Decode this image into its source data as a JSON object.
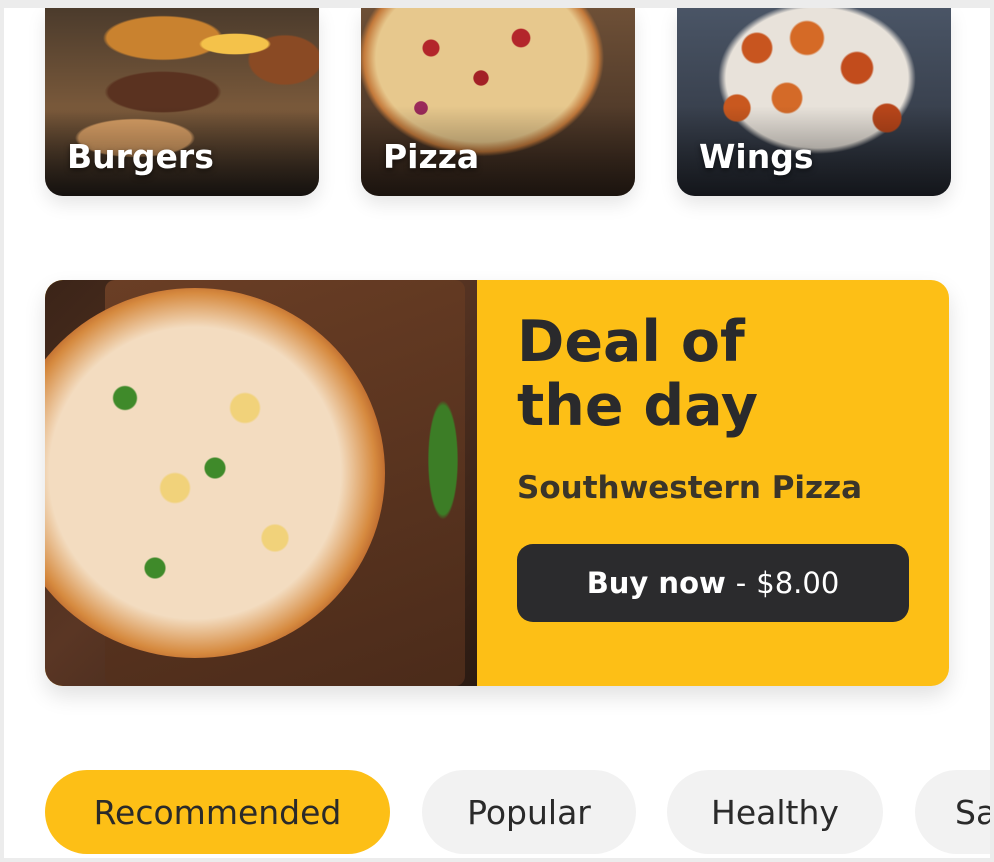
{
  "categories": [
    {
      "label": "Burgers"
    },
    {
      "label": "Pizza"
    },
    {
      "label": "Wings"
    }
  ],
  "deal": {
    "title_line1": "Deal of",
    "title_line2": "the day",
    "product": "Southwestern Pizza",
    "buy_label": "Buy now",
    "buy_separator": "-",
    "price": "$8.00"
  },
  "filters": {
    "items": [
      {
        "label": "Recommended",
        "active": true
      },
      {
        "label": "Popular",
        "active": false
      },
      {
        "label": "Healthy",
        "active": false
      },
      {
        "label": "Sa",
        "active": false
      }
    ]
  },
  "colors": {
    "accent": "#fdbf16",
    "button_dark": "#2b2b2d",
    "pill_inactive": "#f2f2f2",
    "text_dark": "#2a2a2c"
  }
}
